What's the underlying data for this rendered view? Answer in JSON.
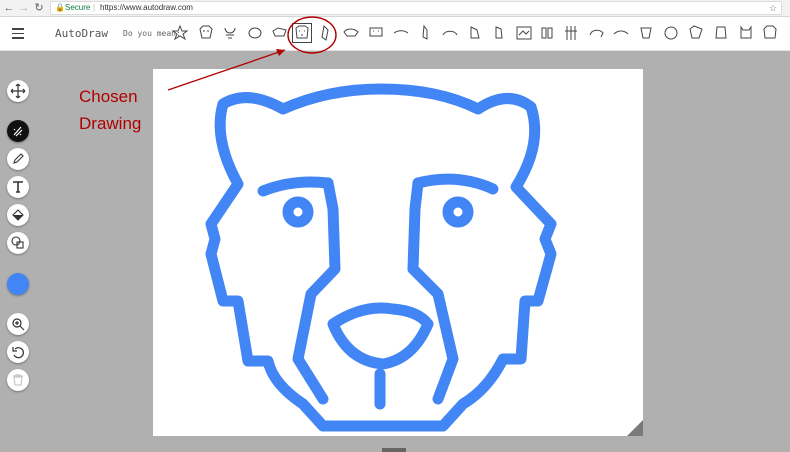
{
  "browser": {
    "secure_label": "Secure",
    "separator": "|",
    "url": "https://www.autodraw.com"
  },
  "app": {
    "brand": "AutoDraw",
    "suggestion_prompt": "Do you mean:",
    "suggestions_count_note": ""
  },
  "annotation": {
    "line1": "Chosen",
    "line2": "Drawing"
  },
  "colors": {
    "stroke": "#4285f4",
    "annotation": "#b00000",
    "background": "#b0b0b0"
  },
  "tools": [
    {
      "name": "move-tool",
      "icon": "move-icon"
    },
    {
      "name": "autodraw-tool",
      "icon": "autodraw-icon"
    },
    {
      "name": "draw-tool",
      "icon": "pencil-icon"
    },
    {
      "name": "type-tool",
      "icon": "text-icon"
    },
    {
      "name": "fill-tool",
      "icon": "fill-icon"
    },
    {
      "name": "shape-tool",
      "icon": "shape-icon"
    },
    {
      "name": "color-tool",
      "icon": "color-swatch"
    },
    {
      "name": "zoom-tool",
      "icon": "zoom-icon"
    },
    {
      "name": "undo-tool",
      "icon": "undo-icon"
    },
    {
      "name": "delete-tool",
      "icon": "trash-icon"
    }
  ]
}
